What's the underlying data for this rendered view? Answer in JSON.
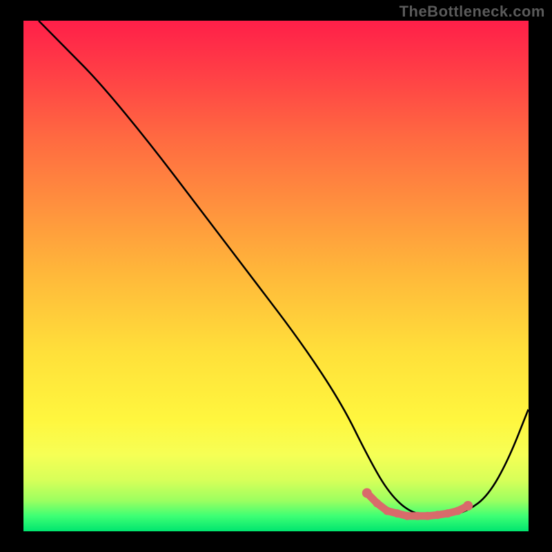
{
  "watermark": "TheBottleneck.com",
  "chart_data": {
    "type": "line",
    "title": "",
    "xlabel": "",
    "ylabel": "",
    "xlim": [
      0,
      100
    ],
    "ylim": [
      0,
      100
    ],
    "series": [
      {
        "name": "bottleneck-curve",
        "x": [
          3,
          8,
          15,
          25,
          35,
          45,
          55,
          63,
          68,
          72,
          76,
          80,
          84,
          88,
          92,
          96,
          100
        ],
        "y": [
          100,
          95,
          88,
          76,
          63,
          50,
          37,
          25,
          15,
          8,
          4,
          3,
          3,
          4,
          7,
          14,
          24
        ]
      }
    ],
    "markers": {
      "name": "highlight-segment",
      "color": "#d96b6b",
      "x": [
        68,
        70,
        72,
        74,
        76,
        78,
        80,
        82,
        84,
        86,
        88
      ],
      "y": [
        7.5,
        5.5,
        4,
        3.5,
        3,
        3,
        3,
        3.2,
        3.5,
        4,
        5
      ]
    },
    "gradient_stops": [
      {
        "pos": 0,
        "color": "#ff1f49"
      },
      {
        "pos": 10,
        "color": "#ff3e46"
      },
      {
        "pos": 23,
        "color": "#ff6a41"
      },
      {
        "pos": 35,
        "color": "#ff8d3e"
      },
      {
        "pos": 50,
        "color": "#ffb93a"
      },
      {
        "pos": 65,
        "color": "#ffe03a"
      },
      {
        "pos": 78,
        "color": "#fff63e"
      },
      {
        "pos": 85,
        "color": "#f6ff55"
      },
      {
        "pos": 90,
        "color": "#d7ff59"
      },
      {
        "pos": 94,
        "color": "#9cff60"
      },
      {
        "pos": 97,
        "color": "#3eff74"
      },
      {
        "pos": 100,
        "color": "#00e56f"
      }
    ]
  }
}
